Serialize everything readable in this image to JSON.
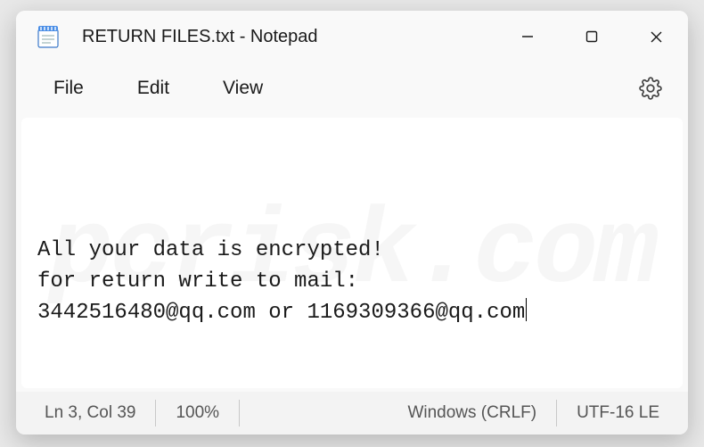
{
  "titlebar": {
    "title": "RETURN FILES.txt - Notepad"
  },
  "menubar": {
    "file": "File",
    "edit": "Edit",
    "view": "View"
  },
  "editor": {
    "line1": "All your data is encrypted!",
    "line2": "for return write to mail:",
    "line3": "3442516480@qq.com or 1169309366@qq.com"
  },
  "statusbar": {
    "position": "Ln 3, Col 39",
    "zoom": "100%",
    "line_ending": "Windows (CRLF)",
    "encoding": "UTF-16 LE"
  },
  "watermark": "pcrisk.com",
  "icons": {
    "notepad": "notepad-icon",
    "minimize": "minimize-icon",
    "maximize": "maximize-icon",
    "close": "close-icon",
    "settings": "gear-icon"
  }
}
